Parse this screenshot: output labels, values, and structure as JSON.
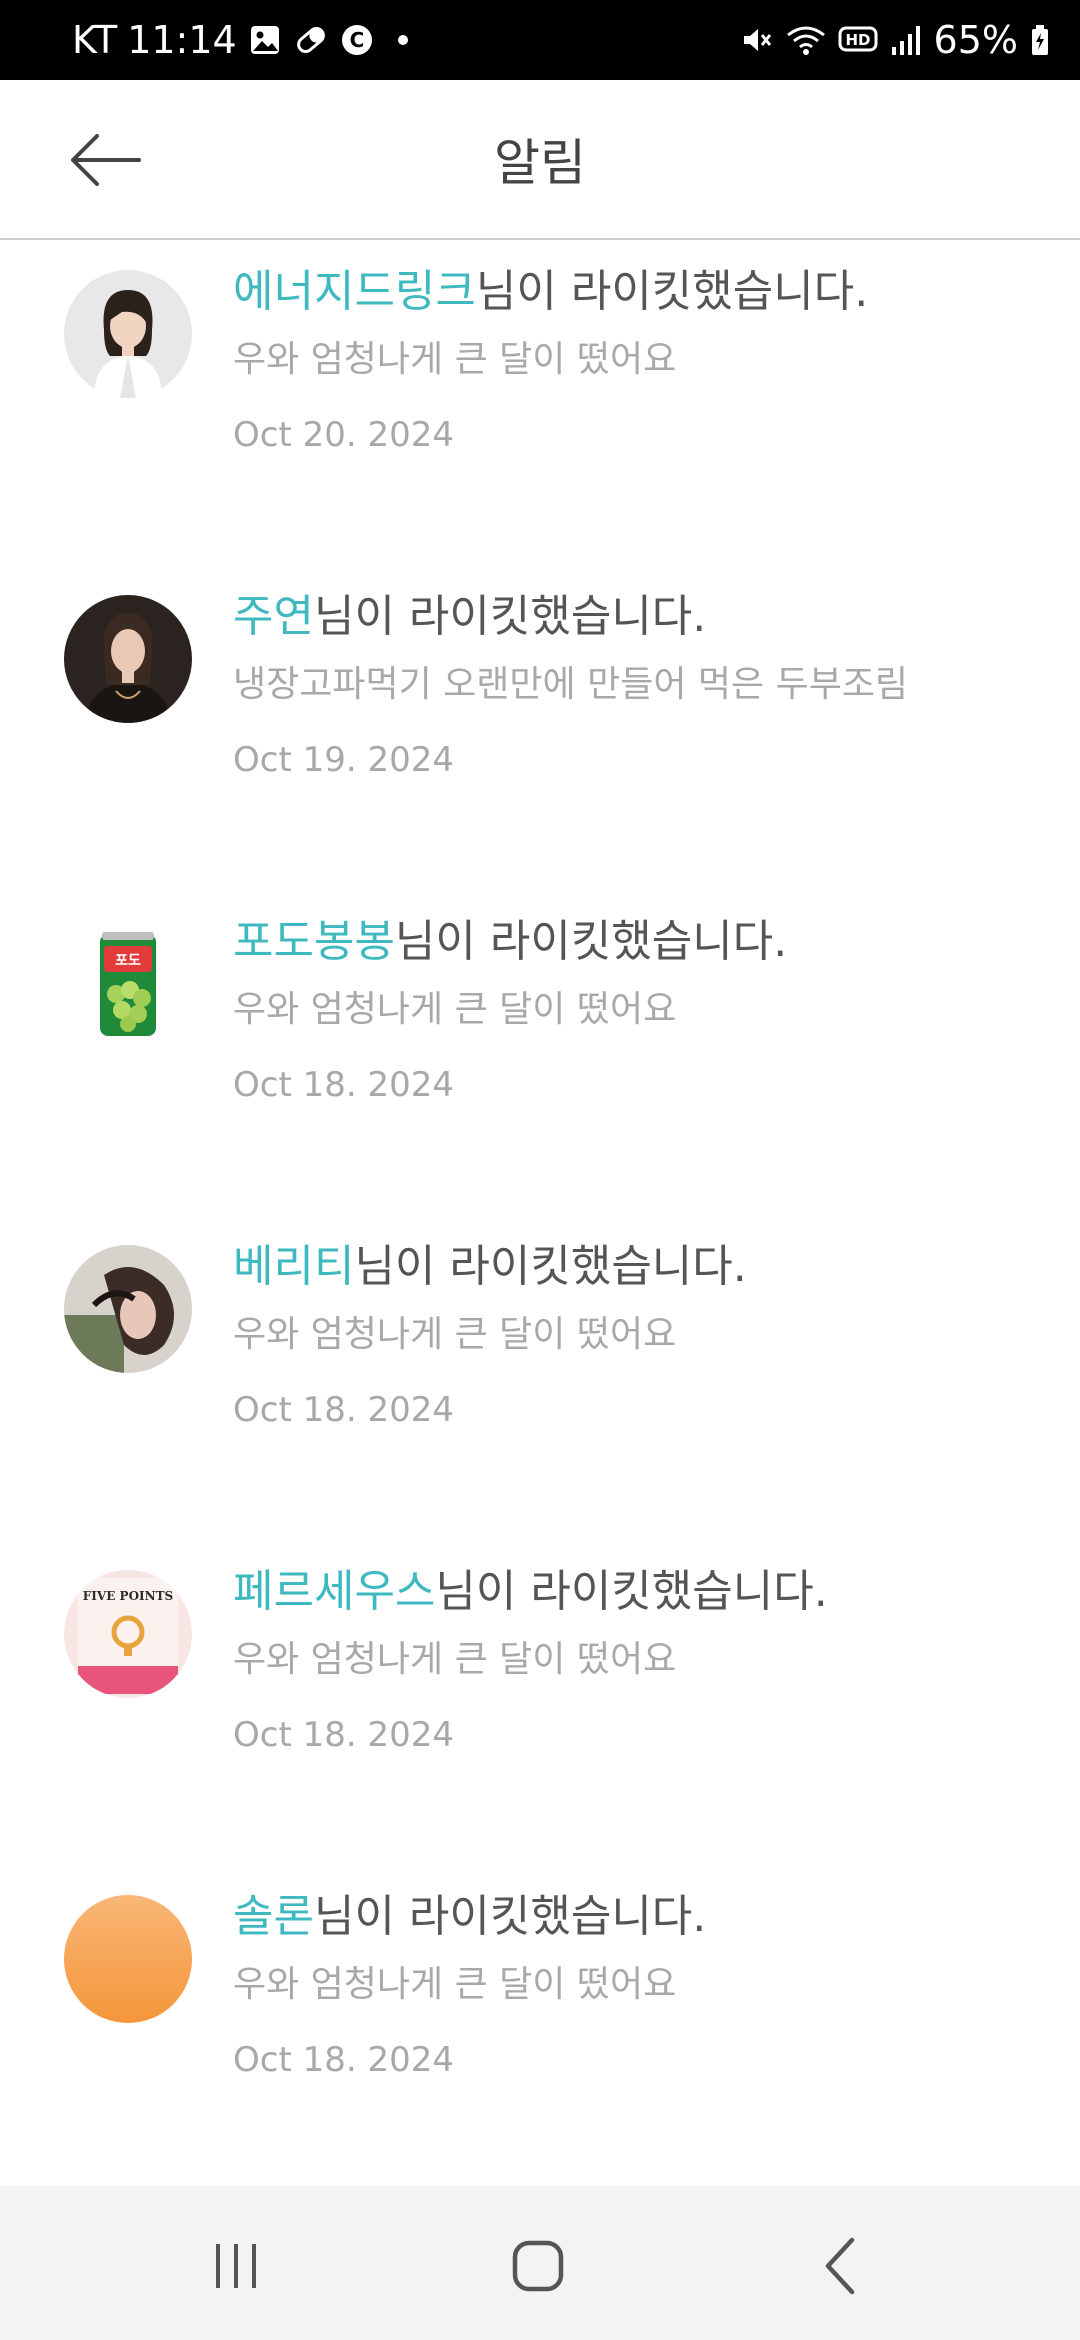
{
  "status_bar": {
    "carrier": "KT",
    "time": "11:14",
    "left_icons": [
      "gallery-icon",
      "pill-icon",
      "c-badge-icon",
      "dot-icon"
    ],
    "right_icons": [
      "mute-icon",
      "wifi-icon",
      "hd-icon",
      "signal-icon"
    ],
    "battery": "65%"
  },
  "header": {
    "title": "알림",
    "back_icon": "arrow-left-icon"
  },
  "notifications": [
    {
      "user": "에너지드링크",
      "action": "님이 라이킷했습니다.",
      "content": "우와 엄청나게 큰 달이 떴어요",
      "date": "Oct 20. 2024",
      "avatar": "person-photo",
      "avatar_color": "#e8e8e8"
    },
    {
      "user": "주연",
      "action": "님이 라이킷했습니다.",
      "content": "냉장고파먹기 오랜만에 만들어 먹은 두부조림",
      "date": "Oct 19. 2024",
      "avatar": "person-photo",
      "avatar_color": "#2a2320"
    },
    {
      "user": "포도봉봉",
      "action": "님이 라이킷했습니다.",
      "content": "우와 엄청나게 큰 달이 떴어요",
      "date": "Oct 18. 2024",
      "avatar": "grape-drink-can",
      "avatar_color": "#ffffff"
    },
    {
      "user": "베리티",
      "action": "님이 라이킷했습니다.",
      "content": "우와 엄청나게 큰 달이 떴어요",
      "date": "Oct 18. 2024",
      "avatar": "person-photo",
      "avatar_color": "#6b6560"
    },
    {
      "user": "페르세우스",
      "action": "님이 라이킷했습니다.",
      "content": "우와 엄청나게 큰 달이 떴어요",
      "date": "Oct 18. 2024",
      "avatar": "book-cover",
      "avatar_color": "#f7e6e3",
      "avatar_text": "FIVE POINTS"
    },
    {
      "user": "솔론",
      "action": "님이 라이킷했습니다.",
      "content": "우와 엄청나게 큰 달이 떴어요",
      "date": "Oct 18. 2024",
      "avatar": "orange-circle",
      "avatar_color": "#f7a24c"
    }
  ],
  "nav_bar": {
    "recents_icon": "recent-apps-icon",
    "home_icon": "home-icon",
    "back_icon": "nav-back-icon"
  },
  "colors": {
    "accent": "#3fb9c0",
    "muted_text": "#a8a8a8",
    "status_bar_bg": "#000000",
    "nav_bar_bg": "#f3f3f5"
  }
}
